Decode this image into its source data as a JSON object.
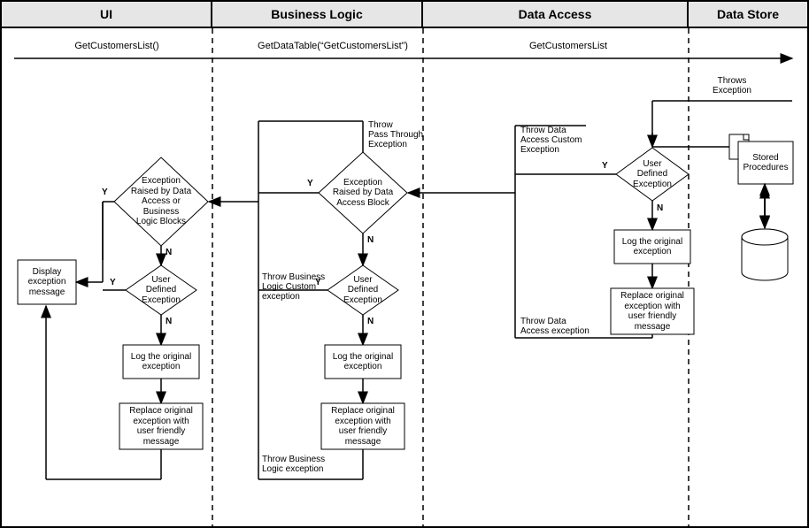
{
  "headers": {
    "ui": "UI",
    "bl": "Business Logic",
    "da": "Data Access",
    "ds": "Data Store"
  },
  "calls": {
    "c1": "GetCustomersList()",
    "c2": "GetDataTable(“GetCustomersList”)",
    "c3": "GetCustomersList"
  },
  "ds": {
    "throws": "Throws\nException",
    "sp": "Stored\nProcedures"
  },
  "da": {
    "decision": "User\nDefined\nException",
    "log": "Log the original\nexception",
    "replace": "Replace original\nexception with\nuser friendly\nmessage",
    "top": "Throw Data\nAccess Custom\nException",
    "bottom": "Throw Data\nAccess exception"
  },
  "bl": {
    "dec1": "Exception\nRaised by Data\nAccess Block",
    "dec2": "User\nDefined\nException",
    "log": "Log the original\nexception",
    "replace": "Replace original\nexception with\nuser friendly\nmessage",
    "top": "Throw\nPass Through\nException",
    "mid": "Throw Business\nLogic Custom\nexception",
    "bot": "Throw Business\nLogic exception"
  },
  "ui": {
    "dec1": "Exception\nRaised by Data\nAccess or Business\nLogic Blocks",
    "dec2": "User\nDefined\nException",
    "display": "Display\nexception\nmessage",
    "log": "Log the original\nexception",
    "replace": "Replace original\nexception with\nuser friendly\nmessage"
  },
  "yn": {
    "Y": "Y",
    "N": "N"
  }
}
